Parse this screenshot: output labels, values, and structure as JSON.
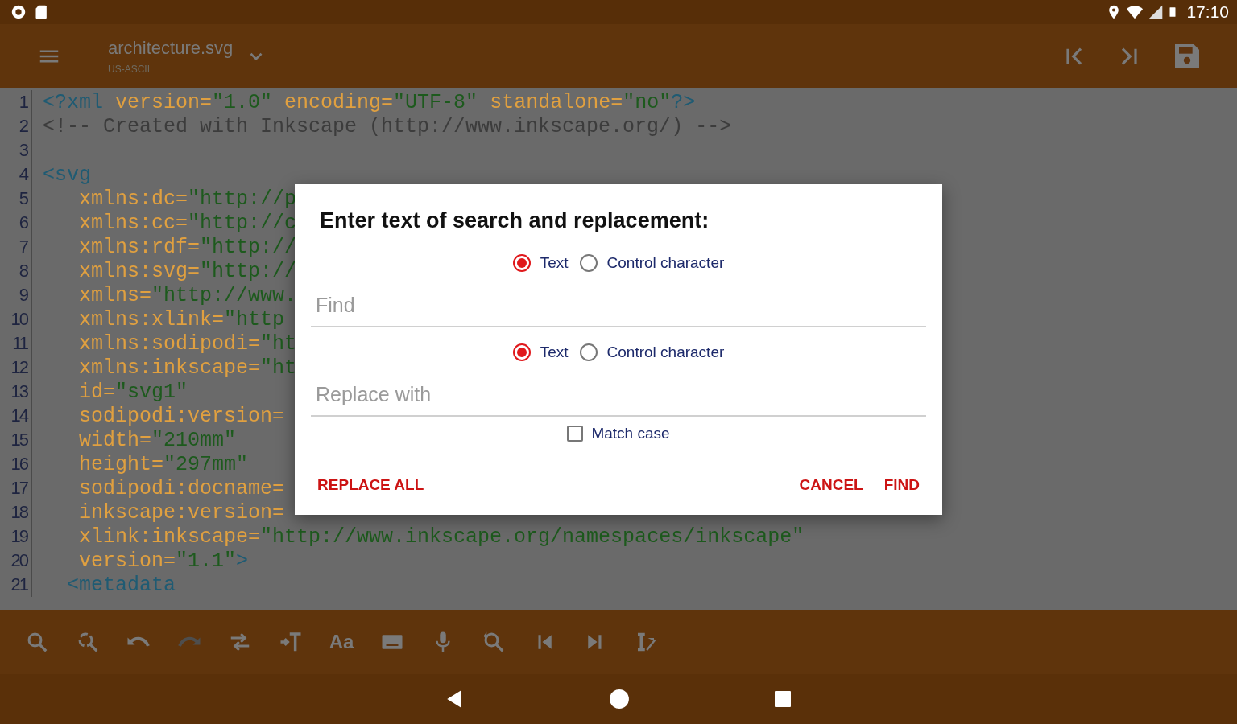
{
  "status_bar": {
    "time": "17:10"
  },
  "app_bar": {
    "title": "architecture.svg",
    "subtitle": "US-ASCII"
  },
  "editor": {
    "lines": [
      {
        "number": "1",
        "segments": [
          {
            "kind": "tag",
            "text": "<?xml "
          },
          {
            "kind": "attr",
            "text": "version="
          },
          {
            "kind": "value",
            "text": "\"1.0\" "
          },
          {
            "kind": "attr",
            "text": "encoding="
          },
          {
            "kind": "value",
            "text": "\"UTF-8\" "
          },
          {
            "kind": "attr",
            "text": "standalone="
          },
          {
            "kind": "value",
            "text": "\"no\""
          },
          {
            "kind": "tag",
            "text": "?>"
          }
        ]
      },
      {
        "number": "2",
        "segments": [
          {
            "kind": "comment",
            "text": "<!-- Created with Inkscape (http://www.inkscape.org/) -->"
          }
        ]
      },
      {
        "number": "3"
      },
      {
        "number": "4",
        "segments": [
          {
            "kind": "tag",
            "text": "<svg"
          }
        ]
      },
      {
        "number": "5",
        "segments": [
          {
            "kind": "attr",
            "text": "   xmlns:dc="
          },
          {
            "kind": "value",
            "text": "\"http://p"
          }
        ]
      },
      {
        "number": "6",
        "segments": [
          {
            "kind": "attr",
            "text": "   xmlns:cc="
          },
          {
            "kind": "value",
            "text": "\"http://c"
          }
        ]
      },
      {
        "number": "7",
        "segments": [
          {
            "kind": "attr",
            "text": "   xmlns:rdf="
          },
          {
            "kind": "value",
            "text": "\"http://"
          }
        ]
      },
      {
        "number": "8",
        "segments": [
          {
            "kind": "attr",
            "text": "   xmlns:svg="
          },
          {
            "kind": "value",
            "text": "\"http://"
          }
        ]
      },
      {
        "number": "9",
        "segments": [
          {
            "kind": "attr",
            "text": "   xmlns="
          },
          {
            "kind": "value",
            "text": "\"http://www."
          }
        ]
      },
      {
        "number": "10",
        "segments": [
          {
            "kind": "attr",
            "text": "   xmlns:xlink="
          },
          {
            "kind": "value",
            "text": "\"http"
          }
        ]
      },
      {
        "number": "11",
        "segments": [
          {
            "kind": "attr",
            "text": "   xmlns:sodipodi="
          },
          {
            "kind": "value",
            "text": "\"ht"
          }
        ]
      },
      {
        "number": "12",
        "segments": [
          {
            "kind": "attr",
            "text": "   xmlns:inkscape="
          },
          {
            "kind": "value",
            "text": "\"ht"
          }
        ]
      },
      {
        "number": "13",
        "segments": [
          {
            "kind": "attr",
            "text": "   id="
          },
          {
            "kind": "value",
            "text": "\"svg1\""
          }
        ]
      },
      {
        "number": "14",
        "segments": [
          {
            "kind": "attr",
            "text": "   sodipodi:version="
          }
        ]
      },
      {
        "number": "15",
        "segments": [
          {
            "kind": "attr",
            "text": "   width="
          },
          {
            "kind": "value",
            "text": "\"210mm\""
          }
        ]
      },
      {
        "number": "16",
        "segments": [
          {
            "kind": "attr",
            "text": "   height="
          },
          {
            "kind": "value",
            "text": "\"297mm\""
          }
        ]
      },
      {
        "number": "17",
        "segments": [
          {
            "kind": "attr",
            "text": "   sodipodi:docname="
          }
        ]
      },
      {
        "number": "18",
        "segments": [
          {
            "kind": "attr",
            "text": "   inkscape:version="
          }
        ]
      },
      {
        "number": "19",
        "segments": [
          {
            "kind": "attr",
            "text": "   xlink:inkscape="
          },
          {
            "kind": "value",
            "text": "\"http://www.inkscape.org/namespaces/inkscape\""
          }
        ]
      },
      {
        "number": "20",
        "segments": [
          {
            "kind": "attr",
            "text": "   version="
          },
          {
            "kind": "value",
            "text": "\"1.1\""
          },
          {
            "kind": "tag",
            "text": ">"
          }
        ]
      },
      {
        "number": "21",
        "segments": [
          {
            "kind": "tag",
            "text": "  <metadata"
          }
        ]
      }
    ]
  },
  "bottom_toolbar": [
    {
      "kind": "icon",
      "disabled": false
    },
    {
      "kind": "icon",
      "disabled": false
    },
    {
      "kind": "icon",
      "disabled": false
    },
    {
      "kind": "icon",
      "disabled": true
    },
    {
      "kind": "icon",
      "disabled": false
    },
    {
      "kind": "icon",
      "disabled": false
    },
    {
      "kind": "text",
      "label": "Aa",
      "disabled": false
    },
    {
      "kind": "icon",
      "disabled": false
    },
    {
      "kind": "icon",
      "disabled": false
    },
    {
      "kind": "icon",
      "disabled": false
    },
    {
      "kind": "icon",
      "disabled": false
    },
    {
      "kind": "icon",
      "disabled": false
    },
    {
      "kind": "icon",
      "disabled": false
    }
  ],
  "dialog": {
    "title": "Enter text of search and replacement:",
    "find_mode": [
      {
        "label": "Text",
        "selected": true
      },
      {
        "label": "Control character",
        "selected": false
      }
    ],
    "find_field": {
      "placeholder": "Find"
    },
    "replace_mode": [
      {
        "label": "Text",
        "selected": true
      },
      {
        "label": "Control character",
        "selected": false
      }
    ],
    "replace_field": {
      "placeholder": "Replace with"
    },
    "match_case": {
      "label": "Match case",
      "checked": false
    },
    "left_buttons": [
      {
        "label": "REPLACE ALL"
      }
    ],
    "right_buttons": [
      {
        "label": "CANCEL"
      },
      {
        "label": "FIND"
      }
    ]
  }
}
